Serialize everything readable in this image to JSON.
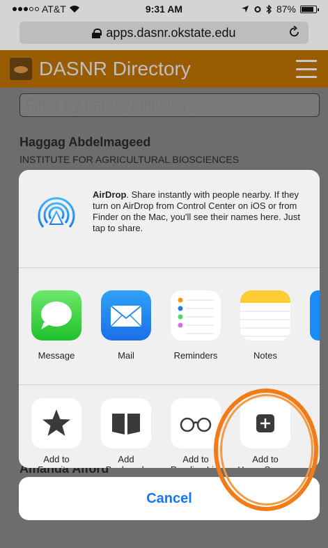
{
  "status": {
    "carrier": "AT&T",
    "time": "9:31 AM",
    "battery": "87%",
    "battery_level": 0.87
  },
  "browser": {
    "url": "apps.dasnr.okstate.edu"
  },
  "app": {
    "title": "DASNR Directory",
    "filter_placeholder": "Filter by name, affiliation, etc…",
    "list": [
      {
        "name": "Haggag Abdelmageed",
        "affiliation": "INSTITUTE FOR AGRICULTURAL BIOSCIENCES"
      },
      {
        "name": "Amanda Alford"
      }
    ]
  },
  "share_sheet": {
    "airdrop_title": "AirDrop",
    "airdrop_text": ". Share instantly with people nearby. If they turn on AirDrop from Control Center on iOS or from Finder on the Mac, you'll see their names here. Just tap to share.",
    "apps": [
      {
        "label": "Message",
        "icon": "message-icon"
      },
      {
        "label": "Mail",
        "icon": "mail-icon"
      },
      {
        "label": "Reminders",
        "icon": "reminders-icon"
      },
      {
        "label": "Notes",
        "icon": "notes-icon"
      }
    ],
    "actions": [
      {
        "label": "Add to\nFavorites",
        "icon": "star-icon"
      },
      {
        "label": "Add\nBookmark",
        "icon": "book-icon"
      },
      {
        "label": "Add to\nReading List",
        "icon": "glasses-icon"
      },
      {
        "label": "Add to\nHome Screen",
        "icon": "plus-square-icon"
      }
    ],
    "cancel": "Cancel"
  },
  "colors": {
    "accent": "#1477f8",
    "annotation": "#f07b17",
    "header": "#9a5c00"
  }
}
